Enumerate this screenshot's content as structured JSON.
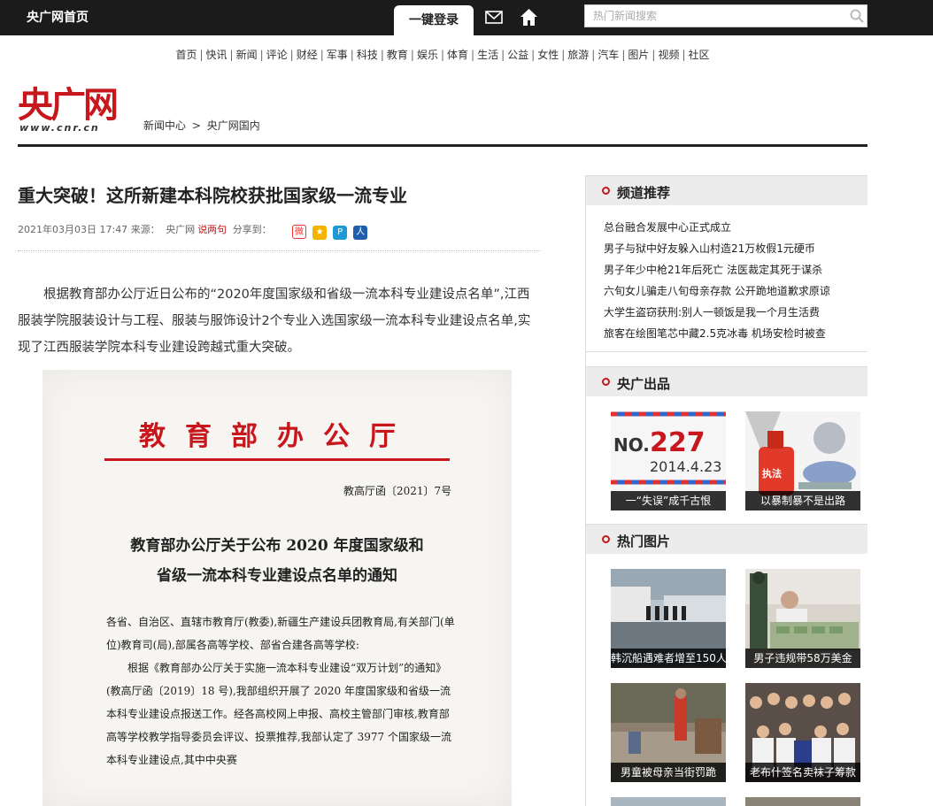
{
  "topbar": {
    "home": "央广网首页",
    "login": "一键登录",
    "search_placeholder": "热门新闻搜索"
  },
  "nav": [
    "首页",
    "快讯",
    "新闻",
    "评论",
    "财经",
    "军事",
    "科技",
    "教育",
    "娱乐",
    "体育",
    "生活",
    "公益",
    "女性",
    "旅游",
    "汽车",
    "图片",
    "视频",
    "社区"
  ],
  "logo": {
    "name": "央广网",
    "url": "www.cnr.cn"
  },
  "breadcrumb": {
    "item1": "新闻中心",
    "sep": ">",
    "item2": "央广网国内"
  },
  "article": {
    "title": "重大突破！这所新建本科院校获批国家级一流专业",
    "date": "2021年03月03日 17:47",
    "source_label": "来源：",
    "source": "央广网",
    "comment_link": "说两句",
    "share_label": "分享到：",
    "body": "根据教育部办公厅近日公布的“2020年度国家级和省级一流本科专业建设点名单”,江西服装学院服装设计与工程、服装与服饰设计2个专业入选国家级一流本科专业建设点名单,实现了江西服装学院本科专业建设跨越式重大突破。"
  },
  "document": {
    "header": "教育部办公厅",
    "number": "教高厅函〔2021〕7号",
    "title_line1": "教育部办公厅关于公布 2020 年度国家级和",
    "title_line2": "省级一流本科专业建设点名单的通知",
    "para1": "各省、自治区、直辖市教育厅(教委),新疆生产建设兵团教育局,有关部门(单位)教育司(局),部属各高等学校、部省合建各高等学校:",
    "para2": "根据《教育部办公厅关于实施一流本科专业建设“双万计划”的通知》(教高厅函〔2019〕18 号),我部组织开展了 2020 年度国家级和省级一流本科专业建设点报送工作。经各高校网上申报、高校主管部门审核,教育部高等学校教学指导委员会评议、投票推荐,我部认定了 3977 个国家级一流本科专业建设点,其中中央赛"
  },
  "sidebar": {
    "channel": {
      "title": "频道推荐",
      "items": [
        "总台融合发展中心正式成立",
        "男子与狱中好友躲入山村造21万枚假1元硬币",
        "男子年少中枪21年后死亡 法医裁定其死于谋杀",
        "六旬女儿骗走八旬母亲存款 公开跪地道歉求原谅",
        "大学生盗窃获刑:别人一顿饭是我一个月生活费",
        "旅客在绘图笔芯中藏2.5克冰毒 机场安检时被查"
      ]
    },
    "cnr_products": {
      "title": "央广出品",
      "items": [
        {
          "caption": "一“失误”成千古恨",
          "badge_no": "NO.",
          "badge_num": "227",
          "badge_date": "2014.4.23"
        },
        {
          "caption": "以暴制暴不是出路",
          "stamp": "执法"
        }
      ]
    },
    "hot_pics": {
      "title": "热门图片",
      "items": [
        {
          "caption": "韩沉船遇难者增至150人"
        },
        {
          "caption": "男子违规带58万美金"
        },
        {
          "caption": "男童被母亲当街罚跪"
        },
        {
          "caption": "老布什签名卖袜子筹款"
        }
      ]
    }
  },
  "colors": {
    "brand_red": "#c8161d",
    "topbar": "#1b1b1b",
    "sidebar_head": "#ececec"
  }
}
